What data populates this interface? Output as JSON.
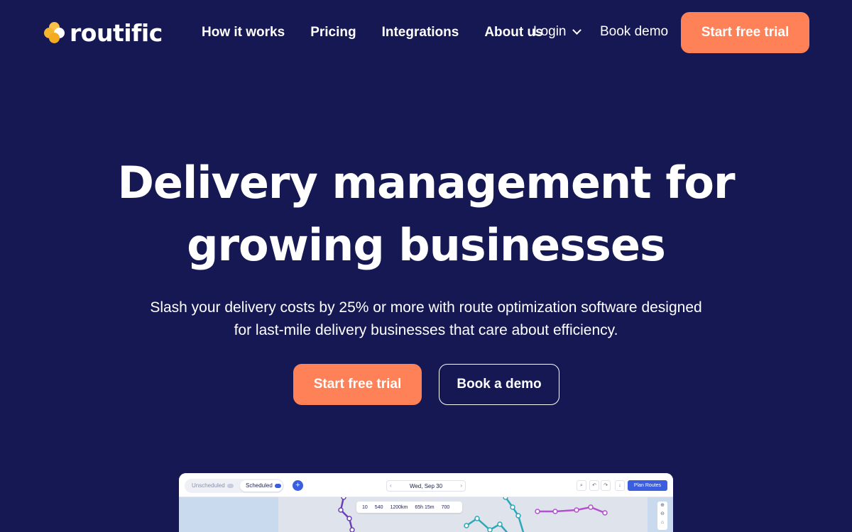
{
  "brand": {
    "name": "routific"
  },
  "nav": {
    "links": [
      "How it works",
      "Pricing",
      "Integrations",
      "About us"
    ],
    "login": "Login",
    "book_demo": "Book demo",
    "cta": "Start free trial"
  },
  "hero": {
    "title_line1": "Delivery management for",
    "title_line2": "growing businesses",
    "subtitle_line1": "Slash your delivery costs by 25% or more with route optimization software designed",
    "subtitle_line2": "for last-mile delivery businesses that care about efficiency.",
    "primary_cta": "Start free trial",
    "secondary_cta": "Book a demo"
  },
  "preview": {
    "tab_unscheduled": "Unscheduled",
    "tab_scheduled": "Scheduled",
    "date": "Wed, Sep 30",
    "plan_routes": "Plan Routes",
    "stats": [
      "10",
      "540",
      "1200km",
      "65h 15m",
      "700"
    ]
  },
  "colors": {
    "background": "#151852",
    "accent": "#ff8157",
    "app_blue": "#3b5ee0"
  },
  "map_routes": [
    {
      "color": "#6a3fb5",
      "points": [
        [
          232,
          0
        ],
        [
          228,
          18
        ],
        [
          240,
          30
        ],
        [
          244,
          46
        ],
        [
          236,
          66
        ]
      ]
    },
    {
      "color": "#2ba8b8",
      "points": [
        [
          460,
          0
        ],
        [
          470,
          14
        ],
        [
          478,
          26
        ],
        [
          490,
          66
        ]
      ]
    },
    {
      "color": "#b34fd0",
      "points": [
        [
          505,
          20
        ],
        [
          530,
          20
        ],
        [
          560,
          18
        ],
        [
          580,
          14
        ],
        [
          600,
          22
        ]
      ]
    },
    {
      "color": "#2ba8b8",
      "points": [
        [
          405,
          40
        ],
        [
          420,
          30
        ],
        [
          438,
          46
        ],
        [
          452,
          38
        ],
        [
          466,
          54
        ]
      ]
    }
  ]
}
